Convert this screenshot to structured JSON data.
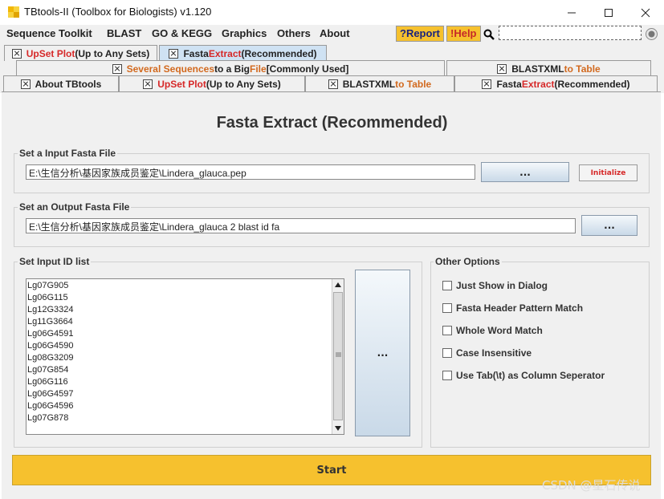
{
  "window": {
    "title": "TBtools-II (Toolbox for Biologists) v1.120",
    "minimize_icon": "minimize-icon",
    "maximize_icon": "maximize-icon",
    "close_icon": "close-icon"
  },
  "menu": {
    "items": [
      "Sequence Toolkit",
      "BLAST",
      "GO & KEGG",
      "Graphics",
      "Others",
      "About"
    ],
    "report": "?Report",
    "help": "!Help",
    "search_icon": "magnifier-icon"
  },
  "tabs": {
    "row1": [
      {
        "a": "UpSet Plot",
        "b": " (Up to Any Sets)"
      },
      {
        "a": "Fasta ",
        "b": "Extract",
        "c": " (Recommended)"
      }
    ],
    "row2": [
      {
        "a": "Several Sequences",
        "b": " to a Big ",
        "c": "File",
        "d": " [Commonly Used]"
      },
      {
        "a": "BLASTXML",
        "b": " to Table"
      }
    ],
    "row3": [
      {
        "a": "About TBtools"
      },
      {
        "a": "UpSet Plot",
        "b": " (Up to Any Sets)"
      },
      {
        "a": "BLASTXML",
        "b": " to Table"
      },
      {
        "a": "Fasta ",
        "b": "Extract",
        "c": " (Recommended)"
      }
    ]
  },
  "main": {
    "heading": "Fasta Extract (Recommended)",
    "input_fasta": {
      "label": "Set a Input Fasta File",
      "value": "E:\\生信分析\\基因家族成员鉴定\\Lindera_glauca.pep",
      "browse": "...",
      "initialize": "Initialize"
    },
    "output_fasta": {
      "label": "Set an Output Fasta File",
      "value": "E:\\生信分析\\基因家族成员鉴定\\Lindera_glauca 2 blast id fa",
      "browse": "..."
    },
    "id_list": {
      "label": "Set Input ID list",
      "items": [
        "Lg07G905",
        "Lg06G115",
        "Lg12G3324",
        "Lg11G3664",
        "Lg06G4591",
        "Lg06G4590",
        "Lg08G3209",
        "Lg07G854",
        "Lg06G116",
        "Lg06G4597",
        "Lg06G4596",
        "Lg07G878"
      ],
      "browse": "..."
    },
    "options": {
      "label": "Other Options",
      "items": [
        "Just Show in Dialog",
        "Fasta Header Pattern Match",
        "Whole Word Match",
        "Case Insensitive",
        "Use Tab(\\t) as Column Seperator"
      ]
    },
    "start": "Start"
  },
  "watermark": "CSDN @星石传说",
  "colors": {
    "accent_yellow": "#f6c12e",
    "tab_selected": "#cfe2f3",
    "red_text": "#d62828",
    "orange_text": "#d2691e"
  }
}
